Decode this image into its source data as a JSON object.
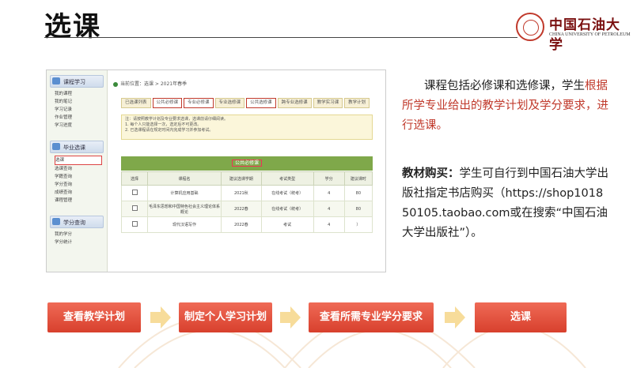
{
  "slide": {
    "title": "选课"
  },
  "logo": {
    "cn": "中国石油大学",
    "en": "CHINA UNIVERSITY OF PETROLEUM"
  },
  "screenshot": {
    "sidebar": {
      "sections": [
        {
          "title": "课程学习",
          "items": [
            "我的课程",
            "我的笔记",
            "学习记录",
            "作业管理",
            "学习进度"
          ]
        },
        {
          "title": "毕业选课",
          "items": [
            "选课",
            "选课查询",
            "学籍查询",
            "学分查询",
            "成绩查询",
            "课程管理"
          ]
        },
        {
          "title": "学分查询",
          "items": [
            "我的学分",
            "学分统计"
          ]
        }
      ],
      "selected": "选课"
    },
    "breadcrumb": "当前位置：选课 > 2021年春季",
    "tabs": [
      "已选课列表",
      "公共必修课",
      "专业必修课",
      "专业选修课",
      "公共选修课",
      "跨专业选修课",
      "教学实习课",
      "教学计划"
    ],
    "active_tabs": [
      "公共必修课",
      "专业必修课",
      "公共选修课"
    ],
    "notice_lines": [
      "注：请按照教学计划及专业要求选课，选课前请仔细阅读。",
      "1. 每个人只能选择一次，选定后不可更改。",
      "2. 已选课程请在规定时间内完成学习并参加考试。"
    ],
    "table": {
      "title": "公共必修课",
      "headers": [
        "选择",
        "课程名",
        "建议选课学期",
        "考试类型",
        "学分",
        "建议课时"
      ],
      "rows": [
        [
          "",
          "计算机应用基础",
          "2021秋",
          "在线考试（统考）",
          "4",
          "80"
        ],
        [
          "",
          "毛泽东思想和中国特色社会主义理论体系概论",
          "2022春",
          "在线考试（统考）",
          "4",
          "80"
        ],
        [
          "",
          "现代汉语写作",
          "2022春",
          "考试",
          "4",
          "）"
        ]
      ]
    }
  },
  "text": {
    "para1_normal": "课程包括必修课和选修课，学生",
    "para1_highlight": "根据所学专业给出的教学计划及学分要求，进行选课。",
    "para2_label": "教材购买：",
    "para2_body": "学生可自行到中国石油大学出版社指定书店购买（https://shop101850105.taobao.com或在搜索“中国石油大学出版社”）。"
  },
  "flow": {
    "steps": [
      "查看教学计划",
      "制定个人学习计划",
      "查看所需专业学分要求",
      "选课"
    ]
  },
  "colors": {
    "accent": "#c0392b",
    "step": "#e0503a",
    "arrow": "#f7dc9a"
  }
}
